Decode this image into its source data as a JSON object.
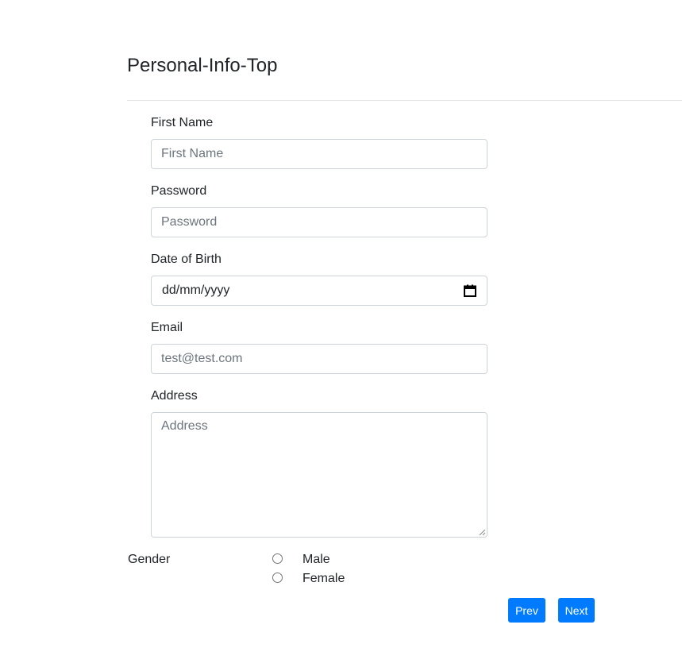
{
  "page": {
    "title": "Personal-Info-Top"
  },
  "form": {
    "first_name": {
      "label": "First Name",
      "placeholder": "First Name",
      "value": ""
    },
    "password": {
      "label": "Password",
      "placeholder": "Password",
      "value": ""
    },
    "dob": {
      "label": "Date of Birth",
      "display": "dd/mm/yyyy",
      "icon": "calendar-icon"
    },
    "email": {
      "label": "Email",
      "placeholder": "test@test.com",
      "value": ""
    },
    "address": {
      "label": "Address",
      "placeholder": "Address",
      "value": ""
    },
    "gender": {
      "label": "Gender",
      "options": [
        {
          "label": "Male",
          "checked": false
        },
        {
          "label": "Female",
          "checked": false
        }
      ]
    }
  },
  "buttons": {
    "prev": "Prev",
    "next": "Next"
  },
  "colors": {
    "primary": "#007bff",
    "border": "#ced4da",
    "text": "#212529",
    "placeholder": "#6c757d"
  }
}
